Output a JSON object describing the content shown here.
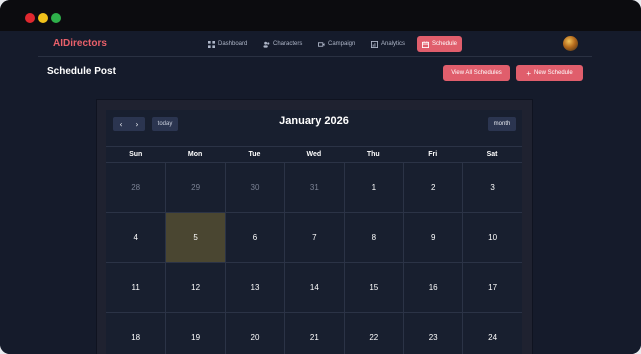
{
  "app": {
    "brand": "AIDirectors",
    "nav": [
      {
        "label": "Dashboard",
        "icon": "grid-icon"
      },
      {
        "label": "Characters",
        "icon": "users-icon"
      },
      {
        "label": "Campaign",
        "icon": "video-icon"
      },
      {
        "label": "Analytics",
        "icon": "chart-icon"
      },
      {
        "label": "Schedule",
        "icon": "calendar-icon",
        "active": true
      }
    ]
  },
  "page": {
    "title": "Schedule Post",
    "buttons": {
      "view_all": "View All Schedules",
      "new_schedule": "New Schedule"
    }
  },
  "calendar": {
    "prev_label": "‹",
    "next_label": "›",
    "today_label": "today",
    "title": "January 2026",
    "view_label": "month",
    "dow": [
      "Sun",
      "Mon",
      "Tue",
      "Wed",
      "Thu",
      "Fri",
      "Sat"
    ],
    "weeks": [
      [
        "28",
        "29",
        "30",
        "31",
        "1",
        "2",
        "3"
      ],
      [
        "4",
        "5",
        "6",
        "7",
        "8",
        "9",
        "10"
      ],
      [
        "11",
        "12",
        "13",
        "14",
        "15",
        "16",
        "17"
      ],
      [
        "18",
        "19",
        "20",
        "21",
        "22",
        "23",
        "24"
      ]
    ],
    "highlighted_day": "5",
    "colors": {
      "accent": "#e05e6c",
      "today_bg": "#4a4631"
    }
  }
}
